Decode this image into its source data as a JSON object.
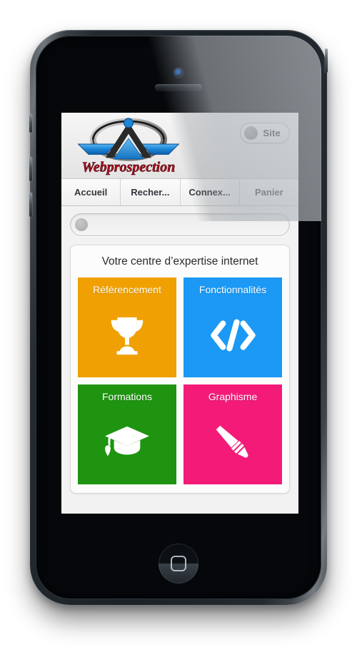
{
  "device": {
    "type": "smartphone-mockup",
    "camera_icon": "front-camera-icon",
    "speaker_icon": "earpiece-speaker-icon",
    "home_button_icon": "home-button-icon"
  },
  "header": {
    "logo_text": "Webprospection",
    "logo_alt": "webprospection-logo",
    "site_toggle": {
      "label": "Site",
      "icon": "circle-toggle-icon"
    }
  },
  "nav": {
    "items": [
      {
        "label": "Accueil",
        "name": "nav-item-accueil"
      },
      {
        "label": "Recher...",
        "name": "nav-item-recherche"
      },
      {
        "label": "Connex...",
        "name": "nav-item-connexion"
      },
      {
        "label": "Panier",
        "name": "nav-item-panier"
      }
    ]
  },
  "search": {
    "value": "",
    "placeholder": "",
    "icon": "circle-icon"
  },
  "panel": {
    "title": "Votre centre d’expertise internet",
    "tiles": [
      {
        "label": "Référencement",
        "color": "#F0A000",
        "icon": "trophy-icon",
        "name": "tile-referencement"
      },
      {
        "label": "Fonctionnalités",
        "color": "#1B99F5",
        "icon": "code-brackets-icon",
        "name": "tile-fonctionnalites"
      },
      {
        "label": "Formations",
        "color": "#1E9410",
        "icon": "graduation-cap-icon",
        "name": "tile-formations"
      },
      {
        "label": "Graphisme",
        "color": "#F41B78",
        "icon": "paintbrush-icon",
        "name": "tile-graphisme"
      }
    ]
  },
  "colors": {
    "orange": "#F0A000",
    "blue": "#1B99F5",
    "green": "#1E9410",
    "pink": "#F41B78",
    "logo_red": "#B01020",
    "logo_blue": "#1E86D6",
    "screen_bg": "#F2F2F2"
  }
}
